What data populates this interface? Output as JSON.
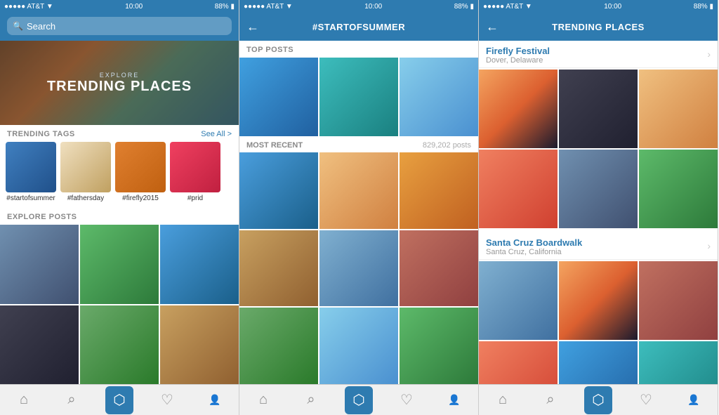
{
  "panels": [
    {
      "id": "explore",
      "statusBar": {
        "signal": "●●●●● AT&T ▼",
        "time": "10:00",
        "battery": "88% ▮"
      },
      "header": {
        "type": "search",
        "searchPlaceholder": "Search"
      },
      "hero": {
        "exploreLabel": "EXPLORE",
        "mainText": "TRENDING PLACES"
      },
      "trendingTags": {
        "title": "TRENDING TAGS",
        "seeAll": "See All >",
        "tags": [
          {
            "label": "#startofsummer",
            "colorClass": "tag-1"
          },
          {
            "label": "#fathersday",
            "colorClass": "tag-2"
          },
          {
            "label": "#firefly2015",
            "colorClass": "tag-3"
          },
          {
            "label": "#prid",
            "colorClass": "tag-4"
          }
        ]
      },
      "explorePosts": {
        "title": "EXPLORE POSTS",
        "cells": [
          "img-city",
          "img-green",
          "img-blue",
          "img-dark",
          "img-nature",
          "img-brown"
        ]
      },
      "bottomNav": [
        {
          "icon": "⌂",
          "label": "home",
          "active": false
        },
        {
          "icon": "⌕",
          "label": "search",
          "active": false
        },
        {
          "icon": "⬡",
          "label": "camera",
          "active": true
        },
        {
          "icon": "♡",
          "label": "likes",
          "active": false
        },
        {
          "icon": "👤",
          "label": "profile",
          "active": false
        }
      ]
    },
    {
      "id": "hashtag",
      "statusBar": {
        "signal": "●●●●● AT&T ▼",
        "time": "10:00",
        "battery": "88% ▮"
      },
      "header": {
        "type": "back-title",
        "title": "#STARTOFSUMMER",
        "back": "←"
      },
      "topPosts": {
        "label": "TOP POSTS",
        "cells": [
          "img-water",
          "img-teal",
          "img-sky"
        ]
      },
      "mostRecent": {
        "label": "MOST RECENT",
        "count": "829,202 posts",
        "cells": [
          "img-blue",
          "img-warm",
          "img-orange",
          "img-brown",
          "img-cool",
          "img-brick",
          "img-nature",
          "img-sky",
          "img-green"
        ]
      },
      "bottomNav": [
        {
          "icon": "⌂",
          "label": "home",
          "active": false
        },
        {
          "icon": "⌕",
          "label": "search",
          "active": false
        },
        {
          "icon": "⬡",
          "label": "camera",
          "active": true
        },
        {
          "icon": "♡",
          "label": "likes",
          "active": false
        },
        {
          "icon": "👤",
          "label": "profile",
          "active": false
        }
      ]
    },
    {
      "id": "trending-places",
      "statusBar": {
        "signal": "●●●●● AT&T ▼",
        "time": "10:00",
        "battery": "88% ▮"
      },
      "header": {
        "type": "back-title",
        "title": "TRENDING PLACES",
        "back": "←"
      },
      "places": [
        {
          "name": "Firefly Festival",
          "location": "Dover, Delaware",
          "photos": [
            "img-sunset",
            "img-dark",
            "img-warm",
            "img-coral",
            "img-city",
            "img-green"
          ]
        },
        {
          "name": "Santa Cruz Boardwalk",
          "location": "Santa Cruz, California",
          "photos": [
            "img-cool",
            "img-sunset",
            "img-brick",
            "img-coral",
            "img-water",
            "img-teal"
          ]
        }
      ],
      "bottomNav": [
        {
          "icon": "⌂",
          "label": "home",
          "active": false
        },
        {
          "icon": "⌕",
          "label": "search",
          "active": false
        },
        {
          "icon": "⬡",
          "label": "camera",
          "active": true
        },
        {
          "icon": "♡",
          "label": "likes",
          "active": false
        },
        {
          "icon": "👤",
          "label": "profile",
          "active": false
        }
      ]
    }
  ]
}
